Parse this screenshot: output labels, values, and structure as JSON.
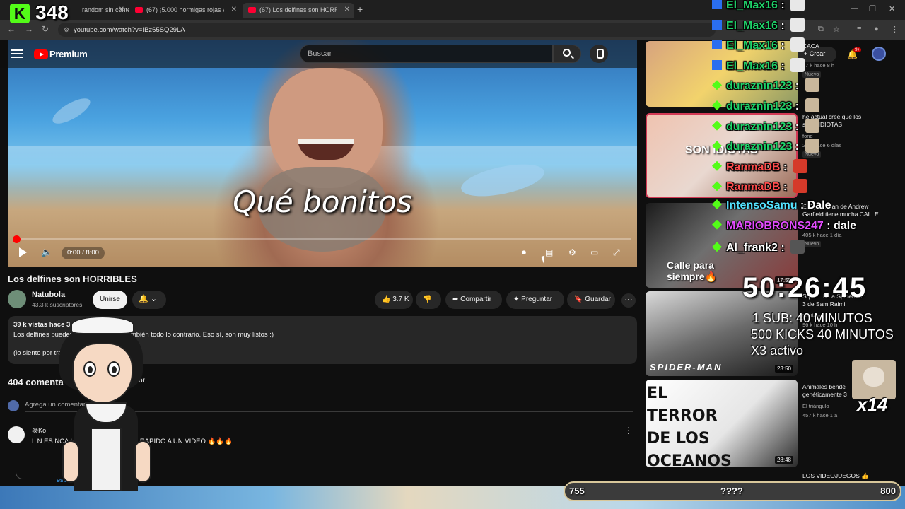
{
  "browser": {
    "tabs": [
      {
        "title": "random sin conte",
        "active": false
      },
      {
        "title": "(67) ¡5.000 hormigas rojas vs 10",
        "active": false
      },
      {
        "title": "(67) Los delfines son HORRIBLE",
        "active": true
      }
    ],
    "new_tab": "+",
    "url": "youtube.com/watch?v=IBz65SQ29LA"
  },
  "youtube": {
    "logo_text": "Premium",
    "search_placeholder": "Buscar",
    "create_label": "Crear",
    "notif_badge": "9+",
    "video": {
      "subtitle": "Qué bonitos",
      "time": "0:00 / 8:00",
      "progress": 0.0
    },
    "title": "Los delfines son HORRIBLES",
    "channel": {
      "name": "Natubola",
      "subs": "43.3 k suscriptores",
      "join": "Unirse"
    },
    "actions": {
      "likes": "3.7 K",
      "share": "Compartir",
      "ask": "Preguntar",
      "save": "Guardar"
    },
    "description": {
      "line1": "39 k vistas  hace 3 días",
      "line2": "Los delfines pueden              muy buenos, pe     también todo lo contrario. Eso sí, son muy listos :)",
      "line3": "(lo siento por                                       trabajando en la mina)  ...más"
    },
    "comments": {
      "count": "404 comenta",
      "sort": "or",
      "add_placeholder": "Agrega un comentario",
      "first": {
        "user": "@Ko",
        "text": "L            N          ES       NCA HABIA LLEGASO TAN RAPIDO A UN VIDEO 🔥🔥🔥",
        "replies": "espu"
      }
    },
    "recommendations": [
      {
        "title": "CACA",
        "meta": "17 k  hace 8 h",
        "tag": "Nuevo"
      },
      {
        "title": "he actual cree que los\ns son IDIOTAS",
        "meta1": "fond",
        "meta": "25 k  hace 6 días",
        "tag": "Nuevo",
        "overlay": "SON IDIOTAS"
      },
      {
        "title": "El Spiderman de Andrew\nGarfield tiene mucha CALLE",
        "meta1": "Tieson",
        "meta": "405 k  hace 1 día",
        "tag": "Nuevo",
        "overlay": "Calle para siempre🔥"
      },
      {
        "title": "Sq        ba a Spiderman\n3 de Sam Raimi",
        "meta1": "Da     Ilaino",
        "meta": "96 k   hace 10 h",
        "duration": "23:50",
        "overlay": "SPIDER-MAN"
      },
      {
        "title": "Animales bende\ngenéticamente 3",
        "meta1": "El triángulo",
        "meta": "457 k  hace 1 a",
        "duration": "28:48",
        "overlay": "EL TERROR DE LOS OCEANOS"
      },
      {
        "title": "LOS VIDEOJUEGOS 👍",
        "meta": ""
      }
    ],
    "rec_durations": {
      "r1": "17:55"
    }
  },
  "stream": {
    "kick_letter": "K",
    "viewer_count": "348",
    "chat": [
      {
        "user": "El_Max16",
        "color": "#1fd36a",
        "badge": "#2a6ef0",
        "msg": "",
        "emote": "#e8e8e8"
      },
      {
        "user": "El_Max16",
        "color": "#1fd36a",
        "badge": "#2a6ef0",
        "msg": "",
        "emote": "#e8e8e8"
      },
      {
        "user": "El_Max16",
        "color": "#1fd36a",
        "badge": "#2a6ef0",
        "msg": "",
        "emote": "#e8e8e8"
      },
      {
        "user": "El_Max16",
        "color": "#1fd36a",
        "badge": "#2a6ef0",
        "msg": "",
        "emote": "#e8e8e8"
      },
      {
        "user": "duraznin123",
        "color": "#1fd36a",
        "badge": "#53fc18",
        "msg": "",
        "emote": "#c9b79c"
      },
      {
        "user": "duraznin123",
        "color": "#1fd36a",
        "badge": "#53fc18",
        "msg": "",
        "emote": "#c9b79c"
      },
      {
        "user": "duraznin123",
        "color": "#1fd36a",
        "badge": "#53fc18",
        "msg": "",
        "emote": "#c9b79c"
      },
      {
        "user": "duraznin123",
        "color": "#1fd36a",
        "badge": "#53fc18",
        "msg": "",
        "emote": "#c9b79c"
      },
      {
        "user": "RanmaDB",
        "color": "#ff4d4d",
        "badge": "#53fc18",
        "msg": "",
        "emote": "#d53a2a"
      },
      {
        "user": "RanmaDB",
        "color": "#ff4d4d",
        "badge": "#53fc18",
        "msg": "",
        "emote": "#d53a2a"
      },
      {
        "user": "IntensoSamu",
        "color": "#54e3ff",
        "badge": "#53fc18",
        "msg": "Dale",
        "emote": ""
      },
      {
        "user": "MARIOBRONS247",
        "color": "#e44cff",
        "badge": "#53fc18",
        "msg": "dale",
        "emote": ""
      },
      {
        "user": "Al_frank2",
        "color": "#ffffff",
        "badge": "#53fc18",
        "msg": "",
        "emote": "#555555"
      }
    ],
    "timer": "50:26:45",
    "goals": [
      "1 SUB: 40 MINUTOS",
      "500 KICKS 40 MINUTOS",
      "X3 activo"
    ],
    "multiplier": "x14",
    "goal_bar": {
      "start": "755",
      "middle": "????",
      "end": "800",
      "progress": 0.0
    }
  }
}
